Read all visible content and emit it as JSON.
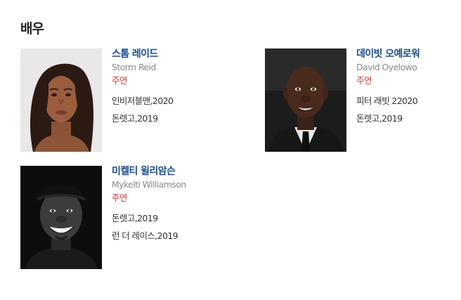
{
  "section": {
    "title": "배우"
  },
  "actors": [
    {
      "name_ko": "스톰 레이드",
      "name_en": "Storm Reid",
      "role": "주연",
      "works": [
        {
          "title": "인비저블맨",
          "year": "2020"
        },
        {
          "title": "돈렛고",
          "year": "2019"
        }
      ]
    },
    {
      "name_ko": "데이빗 오예로워",
      "name_en": "David Oyelowo",
      "role": "주연",
      "works": [
        {
          "title": "피터 래빗 2",
          "year": "2020"
        },
        {
          "title": "돈렛고",
          "year": "2019"
        }
      ]
    },
    {
      "name_ko": "미켈티 윌리암슨",
      "name_en": "Mykelti Williamson",
      "role": "주연",
      "works": [
        {
          "title": "돈렛고",
          "year": "2019"
        },
        {
          "title": "런 더 레이스",
          "year": "2019"
        }
      ]
    }
  ],
  "colors": {
    "name_link": "#1b4b8e",
    "english_name": "#8a8a8a",
    "role": "#c9453e",
    "body_text": "#333333"
  }
}
